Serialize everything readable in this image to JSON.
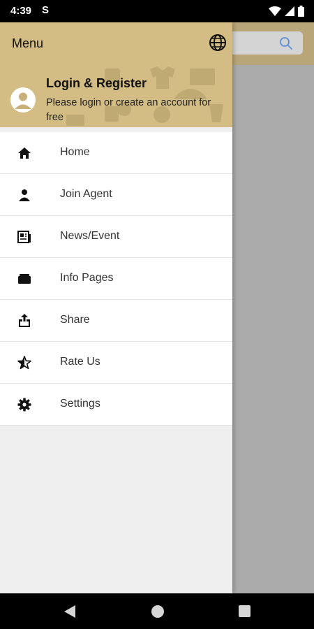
{
  "status_bar": {
    "time": "4:39",
    "sim_label": "S"
  },
  "drawer": {
    "title": "Menu",
    "profile": {
      "title": "Login & Register",
      "subtitle": "Please login or create an account for free"
    },
    "items": [
      {
        "label": "Home",
        "icon": "home-icon"
      },
      {
        "label": "Join Agent",
        "icon": "person-icon"
      },
      {
        "label": "News/Event",
        "icon": "newspaper-icon"
      },
      {
        "label": "Info Pages",
        "icon": "folder-icon"
      },
      {
        "label": "Share",
        "icon": "share-icon"
      },
      {
        "label": "Rate Us",
        "icon": "star-half-icon"
      },
      {
        "label": "Settings",
        "icon": "gear-icon"
      }
    ]
  },
  "colors": {
    "header_gold": "#d3bd84",
    "appbar_gold": "#b9a678",
    "scrim_gray": "#ababab",
    "search_icon_blue": "#5b8fd6"
  }
}
